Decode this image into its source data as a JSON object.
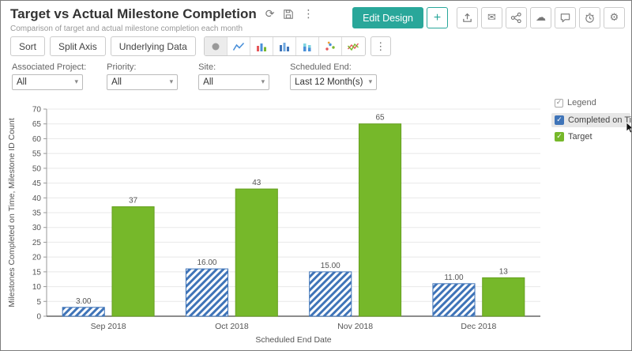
{
  "colors": {
    "accent": "#29a79a"
  },
  "icons": {
    "refresh": "⟳",
    "kebab": "⋮",
    "plus": "+",
    "envelope": "✉",
    "cloud": "☁",
    "gear": "⚙",
    "check": "✓",
    "caret": "▾"
  },
  "header": {
    "title": "Target vs Actual Milestone Completion",
    "subtitle": "Comparison of target and actual milestone completion each month",
    "edit_design": "Edit Design"
  },
  "toolbar": {
    "buttons": [
      "Sort",
      "Split Axis",
      "Underlying Data"
    ]
  },
  "filters": [
    {
      "label": "Associated Project:",
      "value": "All"
    },
    {
      "label": "Priority:",
      "value": "All"
    },
    {
      "label": "Site:",
      "value": "All"
    },
    {
      "label": "Scheduled End:",
      "value": "Last 12 Month(s)"
    }
  ],
  "legend": {
    "title": "Legend",
    "items": [
      {
        "label": "Completed on Time",
        "color": "#3f74b8",
        "checked": true
      },
      {
        "label": "Target",
        "color": "#76b82a",
        "checked": true
      }
    ]
  },
  "chart_data": {
    "type": "bar",
    "categories": [
      "Sep 2018",
      "Oct 2018",
      "Nov 2018",
      "Dec 2018"
    ],
    "series": [
      {
        "name": "Completed on Time",
        "values": [
          3,
          16,
          15,
          11
        ],
        "labels": [
          "3.00",
          "16.00",
          "15.00",
          "11.00"
        ],
        "color": "#3f74b8",
        "pattern": "diagonal-hatch"
      },
      {
        "name": "Target",
        "values": [
          37,
          43,
          65,
          13
        ],
        "labels": [
          "37",
          "43",
          "65",
          "13"
        ],
        "color": "#76b82a",
        "stroke": "#66a01f"
      }
    ],
    "xlabel": "Scheduled End Date",
    "ylabel": "Milestones Completed on Time, Milestone ID Count",
    "ylim": [
      0,
      70
    ],
    "ytick_step": 5,
    "grid": true,
    "legend_position": "right"
  }
}
